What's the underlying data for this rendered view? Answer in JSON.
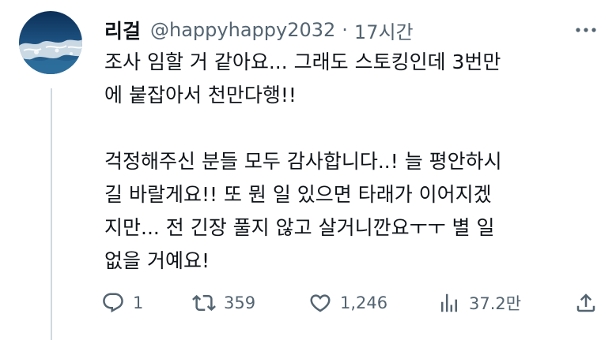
{
  "author": {
    "display_name": "리걸",
    "handle": "@happyhappy2032",
    "separator": "·",
    "timestamp": "17시간",
    "avatar_icon": "ocean-wave-avatar"
  },
  "tweet": {
    "lines": [
      "조사 임할 거 같아요... 그래도 스토킹인데 3번만",
      "에 붙잡아서 천만다행!!",
      "",
      "걱정해주신 분들 모두 감사합니다..! 늘 평안하시",
      "길 바랄게요!! 또 뭔 일 있으면 타래가 이어지겠",
      "지만... 전 긴장 풀지 않고 살거니깐요ㅜㅜ 별 일",
      "없을 거예요!"
    ]
  },
  "actions": {
    "reply": {
      "icon": "reply-icon",
      "count": "1"
    },
    "retweet": {
      "icon": "retweet-icon",
      "count": "359"
    },
    "like": {
      "icon": "heart-icon",
      "count": "1,246"
    },
    "views": {
      "icon": "views-icon",
      "count": "37.2만"
    },
    "share": {
      "icon": "share-icon"
    }
  },
  "colors": {
    "text": "#0f1419",
    "secondary": "#536471",
    "thread_line": "#cfd9de"
  }
}
